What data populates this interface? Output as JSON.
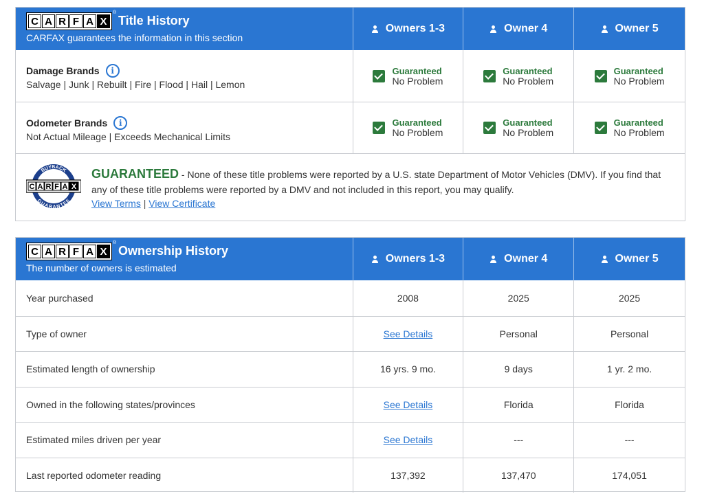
{
  "logo": {
    "letters": [
      "C",
      "A",
      "R",
      "F",
      "A",
      "X"
    ],
    "reg": "®"
  },
  "title_history": {
    "title": "Title History",
    "subtitle": "CARFAX guarantees the information in this section",
    "columns": [
      "Owners 1-3",
      "Owner 4",
      "Owner 5"
    ],
    "rows": [
      {
        "name": "Damage Brands",
        "desc": "Salvage | Junk | Rebuilt | Fire | Flood | Hail | Lemon",
        "status": [
          {
            "g": "Guaranteed",
            "n": "No Problem"
          },
          {
            "g": "Guaranteed",
            "n": "No Problem"
          },
          {
            "g": "Guaranteed",
            "n": "No Problem"
          }
        ]
      },
      {
        "name": "Odometer Brands",
        "desc": "Not Actual Mileage | Exceeds Mechanical Limits",
        "status": [
          {
            "g": "Guaranteed",
            "n": "No Problem"
          },
          {
            "g": "Guaranteed",
            "n": "No Problem"
          },
          {
            "g": "Guaranteed",
            "n": "No Problem"
          }
        ]
      }
    ],
    "guarantee": {
      "headline": "GUARANTEED",
      "text": " - None of these title problems were reported by a U.S. state Department of Motor Vehicles (DMV). If you find that any of these title problems were reported by a DMV and not included in this report, you may qualify.",
      "link_terms": "View Terms",
      "separator": " | ",
      "link_certificate": "View Certificate",
      "seal_top": "BUYBACK",
      "seal_bottom": "GUARANTEE"
    }
  },
  "ownership_history": {
    "title": "Ownership History",
    "subtitle": "The number of owners is estimated",
    "columns": [
      "Owners 1-3",
      "Owner 4",
      "Owner 5"
    ],
    "rows": [
      {
        "label": "Year purchased",
        "values": [
          "2008",
          "2025",
          "2025"
        ]
      },
      {
        "label": "Type of owner",
        "values": [
          "See Details",
          "Personal",
          "Personal"
        ]
      },
      {
        "label": "Estimated length of ownership",
        "values": [
          "16 yrs. 9 mo.",
          "9 days",
          "1 yr. 2 mo."
        ]
      },
      {
        "label": "Owned in the following states/provinces",
        "values": [
          "See Details",
          "Florida",
          "Florida"
        ]
      },
      {
        "label": "Estimated miles driven per year",
        "values": [
          "See Details",
          "---",
          "---"
        ]
      },
      {
        "label": "Last reported odometer reading",
        "values": [
          "137,392",
          "137,470",
          "174,051"
        ]
      }
    ]
  },
  "colors": {
    "header_blue": "#2a76d2",
    "guaranteed_green": "#2c7a3c",
    "border": "#c9ccd1"
  }
}
